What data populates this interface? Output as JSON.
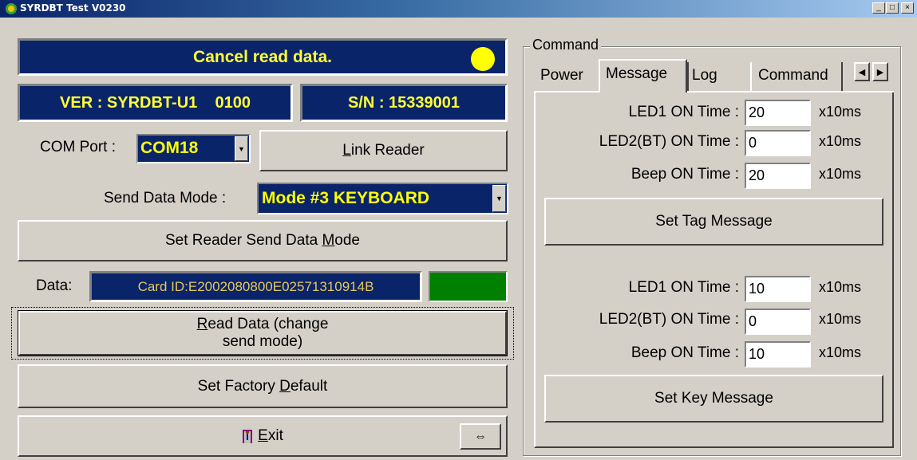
{
  "window": {
    "title": "SYRDBT Test  V0230",
    "minimize": "_",
    "maximize": "□",
    "close": "×"
  },
  "left": {
    "status_message": "Cancel read data.",
    "status_led_color": "#ffff00",
    "version": "VER : SYRDBT-U1    0100",
    "serial": "S/N : 15339001",
    "com_port_label": "COM Port :",
    "com_port_value": "COM18",
    "link_reader_button": {
      "mnemonic": "L",
      "rest": "ink Reader"
    },
    "send_mode_label": "Send Data Mode :",
    "send_mode_value": "Mode #3 KEYBOARD",
    "set_send_mode_button": {
      "before": "Set Reader Send Data ",
      "mnemonic": "M",
      "after": "ode"
    },
    "data_label": "Data:",
    "data_value": "Card ID:E2002080800E02571310914B",
    "data_indicator_color": "#008000",
    "read_data_button": {
      "mnemonic": "R",
      "rest": "ead Data (change send mode)"
    },
    "factory_default_button": {
      "before": "Set Factory ",
      "mnemonic": "D",
      "after": "efault"
    },
    "exit_button": {
      "mnemonic": "E",
      "rest": "xit"
    },
    "resize_button": "⇔"
  },
  "right": {
    "group_title": "Command",
    "tabs": [
      "Power",
      "Message",
      "Log",
      "Command"
    ],
    "active_tab": "Message",
    "tag_message": {
      "rows": [
        {
          "label": "LED1 ON Time :",
          "value": "20",
          "unit": "x10ms"
        },
        {
          "label": "LED2(BT) ON Time :",
          "value": "0",
          "unit": "x10ms"
        },
        {
          "label": "Beep ON Time :",
          "value": "20",
          "unit": "x10ms"
        }
      ],
      "button": "Set Tag Message"
    },
    "key_message": {
      "rows": [
        {
          "label": "LED1 ON Time :",
          "value": "10",
          "unit": "x10ms"
        },
        {
          "label": "LED2(BT) ON Time :",
          "value": "0",
          "unit": "x10ms"
        },
        {
          "label": "Beep ON Time :",
          "value": "10",
          "unit": "x10ms"
        }
      ],
      "button": "Set Key Message"
    }
  }
}
